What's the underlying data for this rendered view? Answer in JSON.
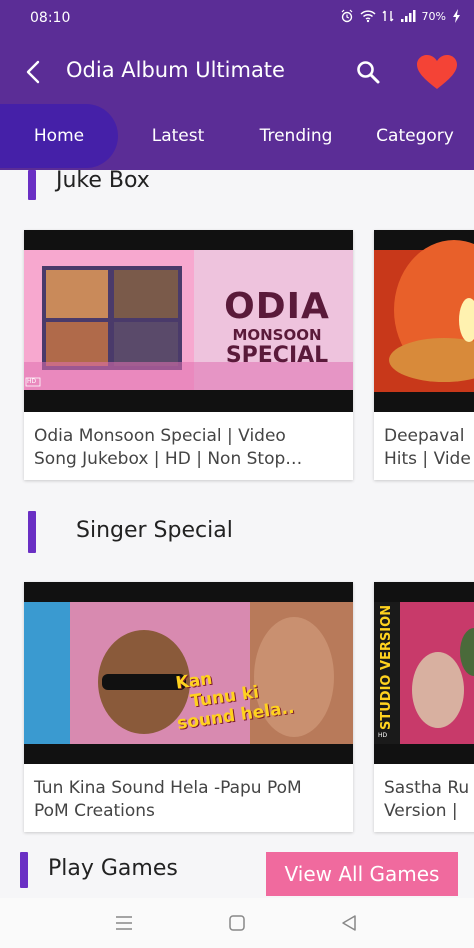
{
  "status_bar": {
    "time": "08:10",
    "battery": "70%",
    "icons": [
      "alarm-icon",
      "wifi-icon",
      "data-icon",
      "signal-icon",
      "battery-charging-icon"
    ]
  },
  "app_bar": {
    "title": "Odia Album Ultimate",
    "icons": [
      "back-arrow-icon",
      "search-icon",
      "heart-icon"
    ],
    "heart_color": "#f44336"
  },
  "tabs": [
    {
      "label": "Home",
      "selected": true
    },
    {
      "label": "Latest",
      "selected": false
    },
    {
      "label": "Trending",
      "selected": false
    },
    {
      "label": "Category",
      "selected": false
    }
  ],
  "sections": [
    {
      "title": "Juke Box",
      "cards": [
        {
          "thumbnail_text": [
            "ODIA",
            "MONSOON",
            "SPECIAL"
          ],
          "badge": "HD",
          "caption_lines": [
            "Odia Monsoon Special | Video",
            "Song Jukebox | HD | Non Stop…"
          ]
        },
        {
          "thumbnail_text": [],
          "caption_lines": [
            "Deepaval",
            "Hits | Vide"
          ]
        }
      ]
    },
    {
      "title": "Singer Special",
      "cards": [
        {
          "thumbnail_text": [
            "Kan",
            "Tunu ki",
            "sound hela.."
          ],
          "caption_lines": [
            "Tun Kina Sound Hela -Papu PoM",
            "PoM Creations"
          ]
        },
        {
          "thumbnail_text": [
            "STUDIO VERSION"
          ],
          "badge": "HD",
          "caption_lines": [
            "Sastha Ru",
            "Version |"
          ]
        }
      ]
    },
    {
      "title": "Play Games",
      "button": "View All Games"
    }
  ],
  "colors": {
    "primary": "#5b2d96",
    "tab_selected": "#4520a8",
    "accent_bar": "#6a2fc4",
    "view_all_button": "#f06a9e"
  },
  "nav_bar": {
    "icons": [
      "recent-apps-icon",
      "home-icon",
      "back-icon"
    ]
  }
}
